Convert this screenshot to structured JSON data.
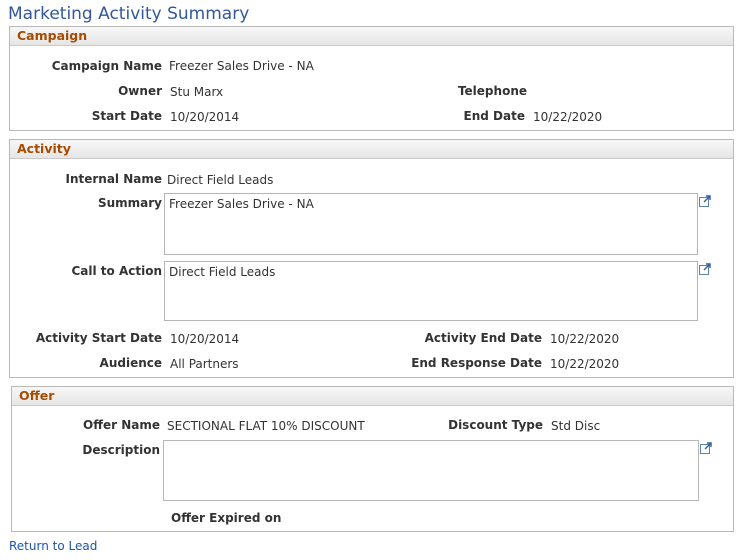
{
  "page": {
    "title": "Marketing Activity Summary"
  },
  "campaign": {
    "header": "Campaign",
    "campaign_name_label": "Campaign Name",
    "campaign_name": "Freezer Sales Drive - NA",
    "owner_label": "Owner",
    "owner": "Stu Marx",
    "telephone_label": "Telephone",
    "start_date_label": "Start Date",
    "start_date": "10/20/2014",
    "end_date_label": "End Date",
    "end_date": "10/22/2020"
  },
  "activity": {
    "header": "Activity",
    "internal_name_label": "Internal Name",
    "internal_name": "Direct Field Leads",
    "summary_label": "Summary",
    "summary": "Freezer Sales Drive - NA",
    "call_to_action_label": "Call to Action",
    "call_to_action": "Direct Field Leads",
    "activity_start_label": "Activity Start Date",
    "activity_start": "10/20/2014",
    "activity_end_label": "Activity End Date",
    "activity_end": "10/22/2020",
    "audience_label": "Audience",
    "audience": "All Partners",
    "end_response_label": "End Response Date",
    "end_response": "10/22/2020"
  },
  "offer": {
    "header": "Offer",
    "offer_name_label": "Offer Name",
    "offer_name": "SECTIONAL FLAT 10% DISCOUNT",
    "discount_type_label": "Discount Type",
    "discount_type": "Std Disc",
    "description_label": "Description",
    "description": "",
    "offer_expired_label": "Offer Expired on"
  },
  "links": {
    "return_to_lead": "Return to Lead"
  },
  "icons": {
    "expand": "expand-field-icon"
  },
  "colors": {
    "title": "#33579a",
    "section_header": "#a54c00",
    "link": "#1d53a8"
  }
}
